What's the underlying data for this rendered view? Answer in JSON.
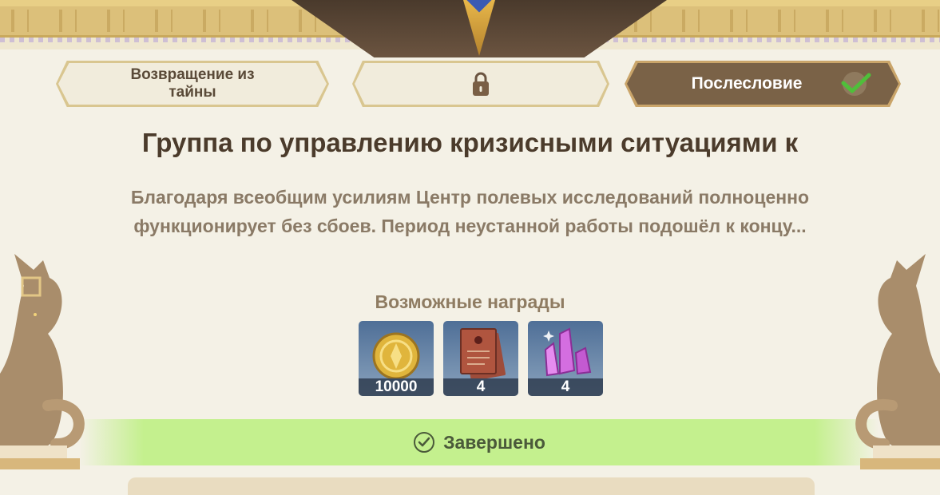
{
  "steps": [
    {
      "label": "Возвращение из тайны",
      "state": "inactive"
    },
    {
      "label": "",
      "state": "locked",
      "icon": "lock-icon"
    },
    {
      "label": "Послесловие",
      "state": "active",
      "icon": "check-icon"
    }
  ],
  "event": {
    "title": "Группа по управлению кризисными ситуациями к",
    "description": "Благодаря всеобщим усилиям Центр полевых исследований полноценно функционирует без сбоев. Период неустанной работы подошёл к концу..."
  },
  "rewards": {
    "label": "Возможные награды",
    "items": [
      {
        "icon": "mora-coin-icon",
        "count": "10000"
      },
      {
        "icon": "book-icon",
        "count": "4"
      },
      {
        "icon": "crystal-icon",
        "count": "4"
      }
    ]
  },
  "status": {
    "label": "Завершено",
    "icon": "check-circle-icon"
  },
  "colors": {
    "accent": "#c4f08e",
    "title": "#4b3b2b",
    "active_tab": "#7a6247",
    "panel": "#f4f1e6"
  }
}
